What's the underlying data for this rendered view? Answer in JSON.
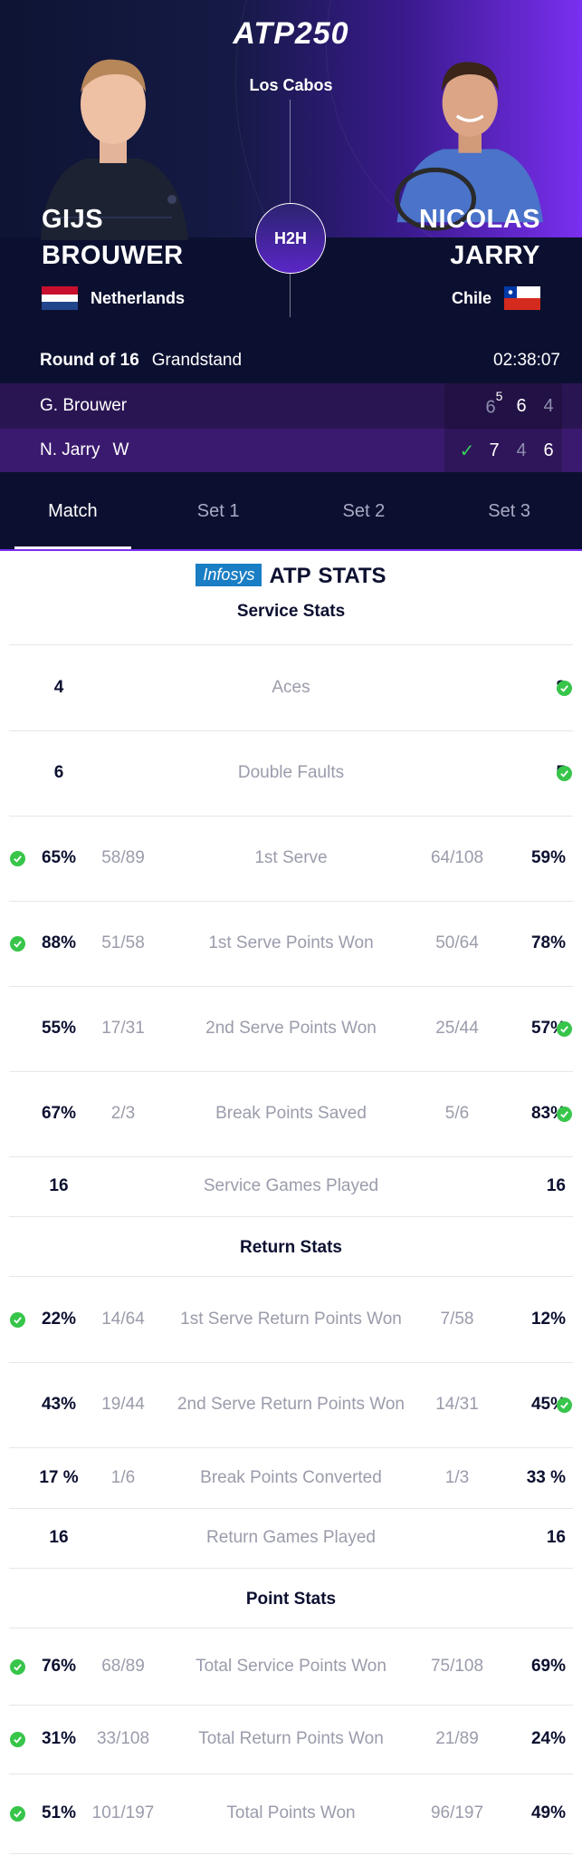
{
  "header": {
    "logo_text": "ATP250",
    "tournament": "Los Cabos",
    "h2h_label": "H2H",
    "player1": {
      "first": "GIJS",
      "last": "BROUWER",
      "country": "Netherlands"
    },
    "player2": {
      "first": "NICOLAS",
      "last": "JARRY",
      "country": "Chile"
    }
  },
  "scoreboard": {
    "round": "Round of 16",
    "court": "Grandstand",
    "duration": "02:38:07",
    "p1": {
      "name": "G. Brouwer",
      "s1": "6",
      "s1_tb": "5",
      "s2": "6",
      "s3": "4"
    },
    "p2": {
      "name": "N. Jarry",
      "winner": "W",
      "s1": "7",
      "s2": "4",
      "s3": "6"
    }
  },
  "tabs": [
    "Match",
    "Set 1",
    "Set 2",
    "Set 3"
  ],
  "stats_brand": {
    "sponsor": "Infosys",
    "title_a": "ATP",
    "title_b": "STATS"
  },
  "sections": {
    "service": "Service Stats",
    "return": "Return Stats",
    "point": "Point Stats"
  },
  "service_stats": [
    {
      "label": "Aces",
      "l": "4",
      "r": "8",
      "lr": "",
      "rr": ""
    },
    {
      "label": "Double Faults",
      "l": "6",
      "r": "5",
      "lr": "",
      "rr": ""
    },
    {
      "label": "1st Serve",
      "l": "65%",
      "r": "59%",
      "lr": "58/89",
      "rr": "64/108"
    },
    {
      "label": "1st Serve Points Won",
      "l": "88%",
      "r": "78%",
      "lr": "51/58",
      "rr": "50/64"
    },
    {
      "label": "2nd Serve Points Won",
      "l": "55%",
      "r": "57%",
      "lr": "17/31",
      "rr": "25/44"
    },
    {
      "label": "Break Points Saved",
      "l": "67%",
      "r": "83%",
      "lr": "2/3",
      "rr": "5/6"
    },
    {
      "label": "Service Games Played",
      "l": "16",
      "r": "16",
      "lr": "",
      "rr": ""
    }
  ],
  "return_stats": [
    {
      "label": "1st Serve Return Points Won",
      "l": "22%",
      "r": "12%",
      "lr": "14/64",
      "rr": "7/58"
    },
    {
      "label": "2nd Serve Return Points Won",
      "l": "43%",
      "r": "45%",
      "lr": "19/44",
      "rr": "14/31"
    },
    {
      "label": "Break Points Converted",
      "l": "17 %",
      "r": "33 %",
      "lr": "1/6",
      "rr": "1/3"
    },
    {
      "label": "Return Games Played",
      "l": "16",
      "r": "16",
      "lr": "",
      "rr": ""
    }
  ],
  "point_stats": [
    {
      "label": "Total Service Points Won",
      "l": "76%",
      "r": "69%",
      "lr": "68/89",
      "rr": "75/108"
    },
    {
      "label": "Total Return Points Won",
      "l": "31%",
      "r": "24%",
      "lr": "33/108",
      "rr": "21/89"
    },
    {
      "label": "Total Points Won",
      "l": "51%",
      "r": "49%",
      "lr": "101/197",
      "rr": "96/197"
    }
  ],
  "colors": {
    "accent": "#7a2ff0",
    "check": "#37c54a",
    "navy": "#0c1030"
  }
}
